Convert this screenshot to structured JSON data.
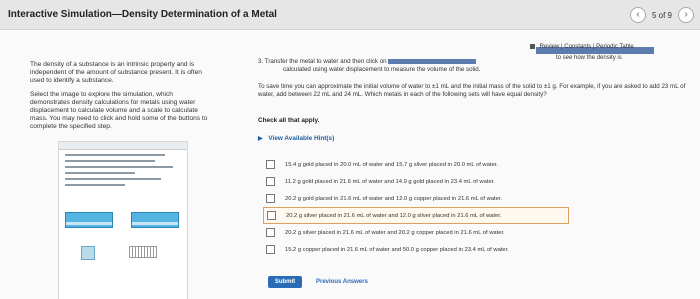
{
  "header": {
    "title": "Interactive Simulation—Density Determination of a Metal",
    "page_count": "5 of 9",
    "prev_glyph": "‹",
    "next_glyph": "›"
  },
  "intro": {
    "p1": "The density of a substance is an intrinsic property and is independent of the amount of substance present. It is often used to identify a substance.",
    "p2": "Select the image to explore the simulation, which demonstrates density calculations for metals using water displacement to calculate volume and a scale to calculate mass. You may need to click and hold some of the buttons to complete the specified step."
  },
  "links": {
    "review": "Review | Constants | Periodic Table",
    "see_density": "to see how the density is"
  },
  "question": {
    "q3_prefix": "3. Transfer the metal to water and then click on",
    "q3_line2": "calculated using water displacement to measure the volume of the solid.",
    "body": "To save time you can approximate the initial volume of water to ±1 mL and the initial mass of the solid to ±1 g. For example, if you are asked to add 23 mL of water, add between 22 mL and 24 mL. Which metals in each of the following sets will have equal density?",
    "check_all": "Check all that apply.",
    "hints": "View Available Hint(s)"
  },
  "choices": [
    {
      "text": "15.4 g gold placed in 20.0 mL of water and 15.7 g silver placed in 20.0 mL of water.",
      "selected": false
    },
    {
      "text": "11.2 g gold placed in 21.6 mL of water and 14.9 g gold placed in 23.4 mL of water.",
      "selected": false
    },
    {
      "text": "20.2 g gold placed in 21.6 mL of water and 12.0 g copper placed in 21.6 mL of water.",
      "selected": false
    },
    {
      "text": "20.2 g silver placed in 21.6 mL of water and 12.0 g silver placed in 21.6 mL of water.",
      "selected": true
    },
    {
      "text": "20.2 g silver placed in 21.6 mL of water and 20.2 g copper placed in 21.6 mL of water.",
      "selected": false
    },
    {
      "text": "15.2 g copper placed in 21.6 mL of water and 50.0 g copper placed in 23.4 mL of water.",
      "selected": false
    }
  ],
  "actions": {
    "submit": "Submit",
    "previous": "Previous Answers"
  },
  "colors": {
    "accent": "#2a6bb8",
    "selected_border": "#e0a060",
    "redacted_bar": "#5d7cae"
  }
}
